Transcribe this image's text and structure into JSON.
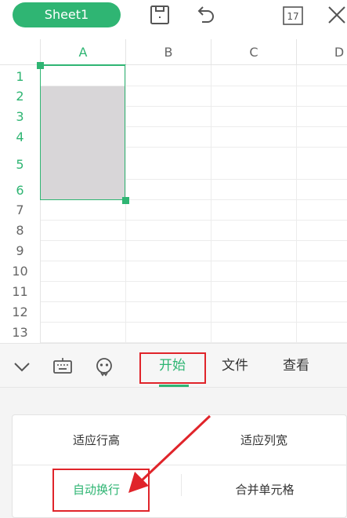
{
  "topbar": {
    "sheet_tab": "Sheet1",
    "icons": [
      "save-icon",
      "undo-icon",
      "calendar-icon",
      "close-icon"
    ],
    "calendar_day": "17"
  },
  "grid": {
    "columns": [
      "A",
      "B",
      "C",
      "D"
    ],
    "rows": [
      "1",
      "2",
      "3",
      "4",
      "5",
      "6",
      "7",
      "8",
      "9",
      "10",
      "11",
      "12",
      "13"
    ],
    "selected_column": "A",
    "selected_rows": [
      "1",
      "2",
      "3",
      "4",
      "5",
      "6"
    ]
  },
  "toolbar": {
    "icons": [
      "collapse-icon",
      "keyboard-icon",
      "emoji-icon"
    ],
    "tabs": [
      "开始",
      "文件",
      "查看"
    ],
    "active_tab": "开始"
  },
  "panel": {
    "fit_row_height": "适应行高",
    "fit_col_width": "适应列宽",
    "wrap_text": "自动换行",
    "merge_cells": "合并单元格"
  },
  "colors": {
    "accent": "#2fb573",
    "annotation": "#e0242a",
    "selection_fill": "#d8d6d8"
  }
}
